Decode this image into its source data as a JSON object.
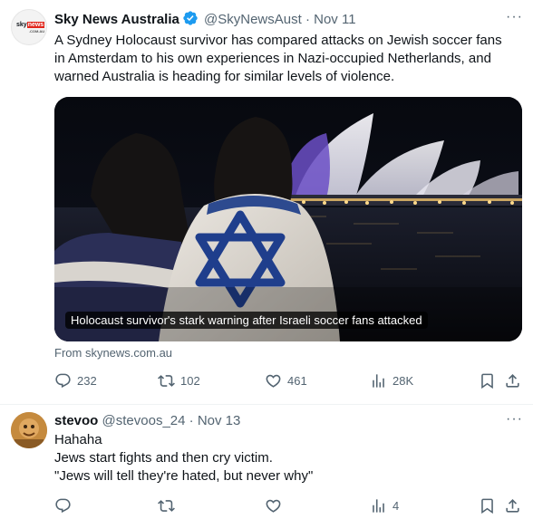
{
  "post1": {
    "author_name": "Sky News Australia",
    "handle": "@SkyNewsAust",
    "separator": "·",
    "date": "Nov 11",
    "avatar_text": {
      "top": "sky",
      "brand": "news",
      "sub": ".COM.AU"
    },
    "text_lines": [
      "A Sydney Holocaust survivor has compared attacks on Jewish soccer fans",
      "in Amsterdam to his own experiences in Nazi-occupied Netherlands, and",
      "warned Australia is heading for similar levels of violence."
    ],
    "card": {
      "caption": "Holocaust survivor's stark warning after Israeli soccer fans attacked",
      "source": "From skynews.com.au"
    },
    "actions": {
      "replies": "232",
      "reposts": "102",
      "likes": "461",
      "views": "28K"
    }
  },
  "post2": {
    "author_name": "stevoo",
    "handle": "@stevoos_24",
    "separator": "·",
    "date": "Nov 13",
    "text_lines": [
      "Hahaha",
      "Jews start fights and then cry victim.",
      "\"Jews will tell they're hated, but never why\""
    ],
    "actions": {
      "replies": "",
      "reposts": "",
      "likes": "",
      "views": "4"
    }
  },
  "colors": {
    "text": "#0f1419",
    "muted": "#536471",
    "verified": "#1d9bf0",
    "sky_red": "#e1251b",
    "divider": "#eff3f4"
  },
  "more_label": "···"
}
